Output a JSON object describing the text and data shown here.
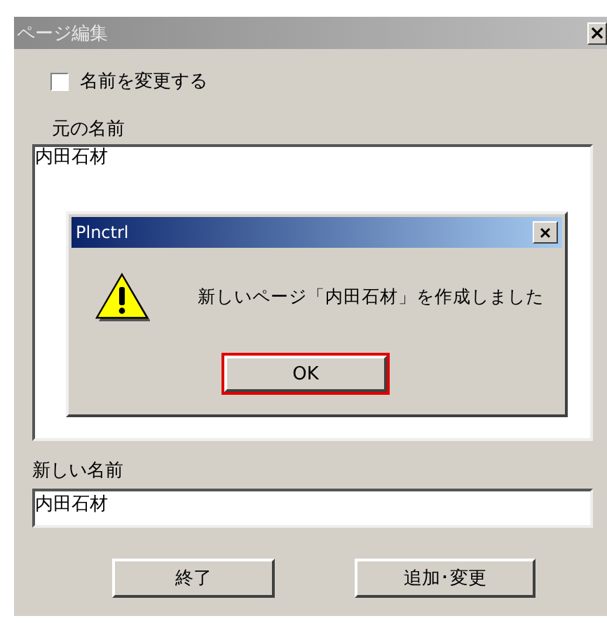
{
  "window": {
    "title": "ページ編集",
    "close": "×"
  },
  "rename_checkbox": {
    "label": "名前を変更する",
    "checked": false
  },
  "original_name": {
    "label": "元の名前",
    "value": "内田石材"
  },
  "dialog": {
    "title": "Plnctrl",
    "close": "×",
    "message": "新しいページ「内田石材」を作成しました",
    "button": "OK"
  },
  "new_name": {
    "label": "新しい名前",
    "value": "内田石材"
  },
  "buttons": [
    "終了",
    "追加･変更"
  ]
}
